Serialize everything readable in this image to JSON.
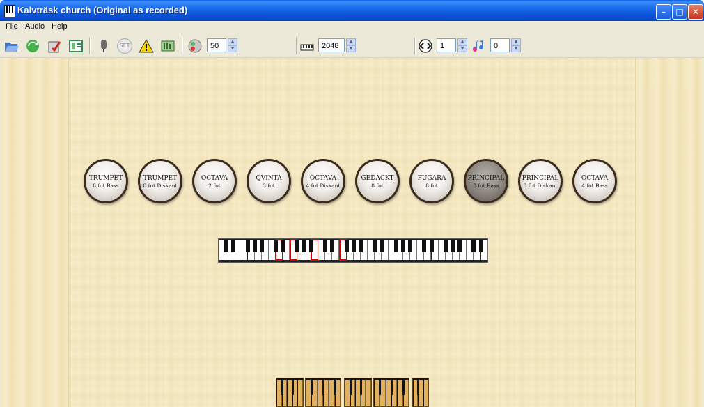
{
  "window": {
    "title": "Kalvträsk church (Original as recorded)"
  },
  "menu": {
    "file": "File",
    "audio": "Audio",
    "help": "Help"
  },
  "toolbar": {
    "icons": [
      "open-icon",
      "reload-icon",
      "save-icon",
      "settings-panel-icon",
      "microphone-icon",
      "set-icon",
      "warning-icon",
      "organ-pipes-icon",
      "volume-icon"
    ],
    "volume_value": "50",
    "polyphony_value": "2048",
    "transpose_value": "1",
    "pitch_value": "0",
    "set_label": "SET"
  },
  "stops": [
    {
      "name": "TRUMPET",
      "detail": "8 fot Bass",
      "on": false
    },
    {
      "name": "TRUMPET",
      "detail": "8 fot Diskant",
      "on": false
    },
    {
      "name": "OCTAVA",
      "detail": "2 fot",
      "on": false
    },
    {
      "name": "QVINTA",
      "detail": "3 fot",
      "on": false
    },
    {
      "name": "OCTAVA",
      "detail": "4 fot Diskant",
      "on": false
    },
    {
      "name": "GEDACKT",
      "detail": "8 fot",
      "on": false
    },
    {
      "name": "FUGARA",
      "detail": "8 fot",
      "on": false
    },
    {
      "name": "PRINCIPAL",
      "detail": "8 fot Bass",
      "on": true
    },
    {
      "name": "PRINCIPAL",
      "detail": "8 fot Diskant",
      "on": false
    },
    {
      "name": "OCTAVA",
      "detail": "4 fot Bass",
      "on": false
    }
  ],
  "colors": {
    "title_bar": "#0A5DEB",
    "wood": "#F7EDC9",
    "key_highlight": "#D80000",
    "stop_frame": "#3a2a1c"
  }
}
